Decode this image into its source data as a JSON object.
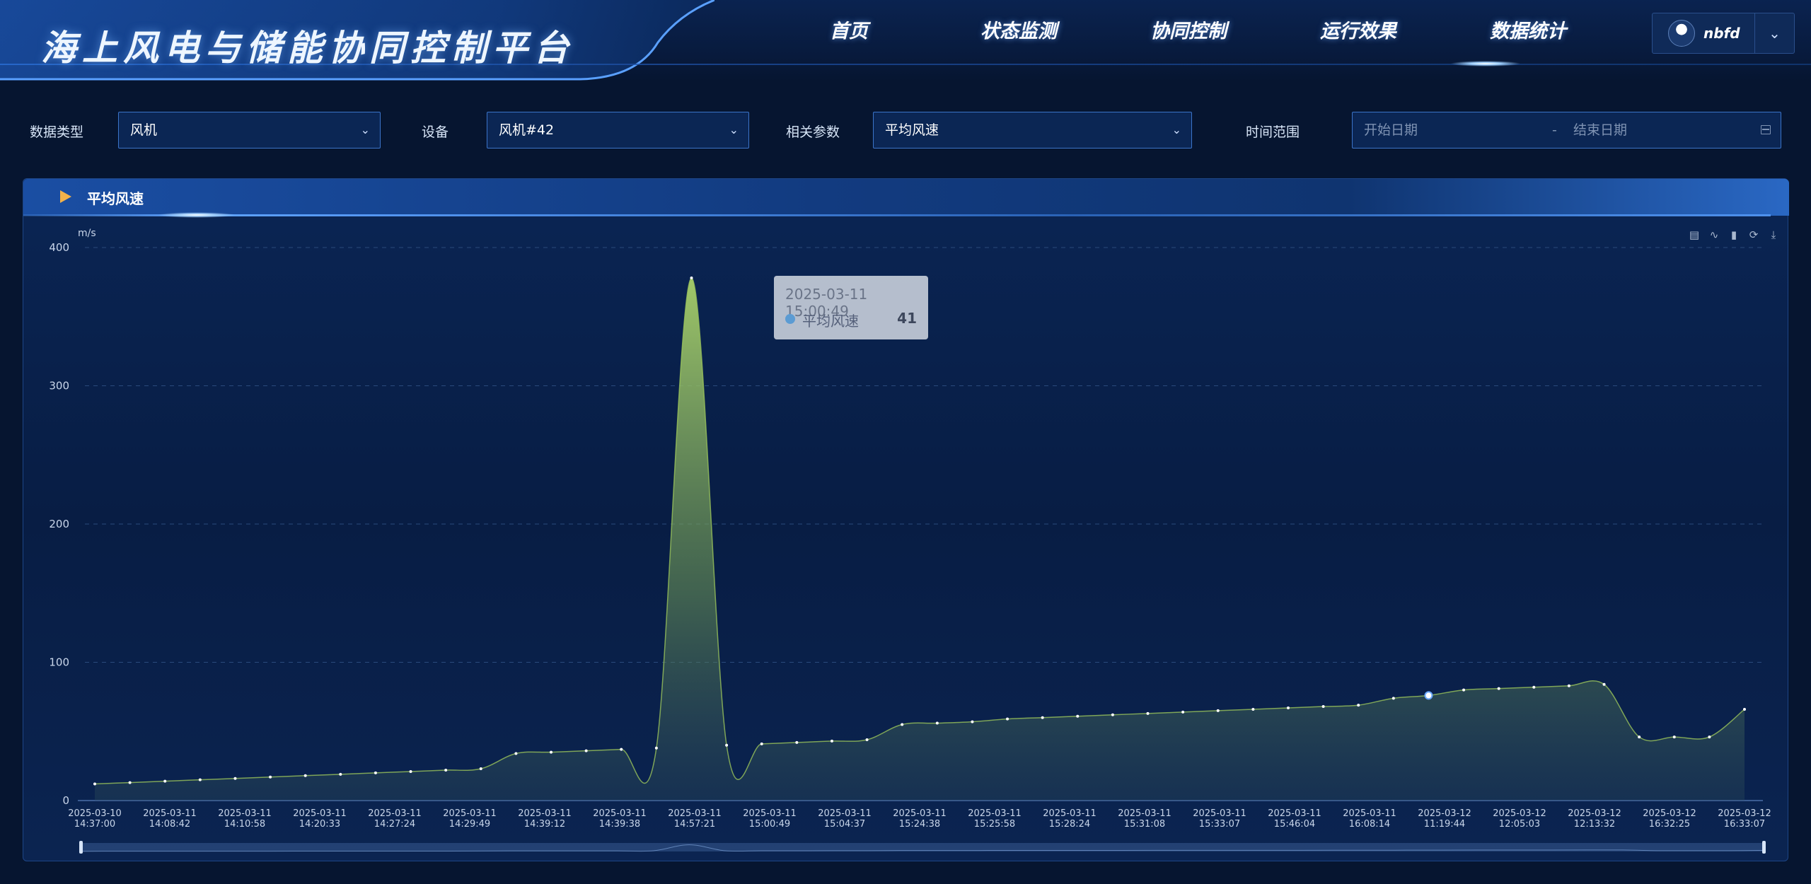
{
  "app": {
    "title": "海上风电与储能协同控制平台"
  },
  "nav": [
    {
      "label": "首页"
    },
    {
      "label": "状态监测"
    },
    {
      "label": "协同控制"
    },
    {
      "label": "运行效果"
    },
    {
      "label": "数据统计"
    }
  ],
  "user": {
    "name": "nbfd"
  },
  "filters": {
    "type_label": "数据类型",
    "type_value": "风机",
    "device_label": "设备",
    "device_value": "风机#42",
    "param_label": "相关参数",
    "param_value": "平均风速",
    "range_label": "时间范围",
    "start_placeholder": "开始日期",
    "separator": "-",
    "end_placeholder": "结束日期"
  },
  "panel": {
    "title": "平均风速"
  },
  "toolbox": [
    "data-view-icon",
    "line-icon",
    "bar-icon",
    "restore-icon",
    "download-icon"
  ],
  "tooltip": {
    "time": "2025-03-11 15:00:49",
    "series": "平均风速",
    "value": "41"
  },
  "colors": {
    "accent": "#3b74c9",
    "series": "#9ac35a",
    "tooltip_dot": "#5b9bd3"
  },
  "chart_data": {
    "type": "area",
    "ylabel": "m/s",
    "ylim": [
      0,
      400
    ],
    "yticks": [
      0,
      100,
      200,
      300,
      400
    ],
    "grid": true,
    "x_labels": [
      [
        "2025-03-10",
        "14:37:00"
      ],
      [
        "2025-03-11",
        "14:08:42"
      ],
      [
        "2025-03-11",
        "14:10:58"
      ],
      [
        "2025-03-11",
        "14:20:33"
      ],
      [
        "2025-03-11",
        "14:27:24"
      ],
      [
        "2025-03-11",
        "14:29:49"
      ],
      [
        "2025-03-11",
        "14:39:12"
      ],
      [
        "2025-03-11",
        "14:39:38"
      ],
      [
        "2025-03-11",
        "14:57:21"
      ],
      [
        "2025-03-11",
        "15:00:49"
      ],
      [
        "2025-03-11",
        "15:04:37"
      ],
      [
        "2025-03-11",
        "15:24:38"
      ],
      [
        "2025-03-11",
        "15:25:58"
      ],
      [
        "2025-03-11",
        "15:28:24"
      ],
      [
        "2025-03-11",
        "15:31:08"
      ],
      [
        "2025-03-11",
        "15:33:07"
      ],
      [
        "2025-03-11",
        "15:46:04"
      ],
      [
        "2025-03-11",
        "16:08:14"
      ],
      [
        "2025-03-12",
        "11:19:44"
      ],
      [
        "2025-03-12",
        "12:05:03"
      ],
      [
        "2025-03-12",
        "12:13:32"
      ],
      [
        "2025-03-12",
        "16:32:25"
      ],
      [
        "2025-03-12",
        "16:33:07"
      ]
    ],
    "values": [
      12,
      13,
      14,
      15,
      16,
      17,
      18,
      19,
      20,
      21,
      22,
      23,
      34,
      35,
      36,
      37,
      38,
      378,
      40,
      41,
      42,
      43,
      44,
      55,
      56,
      57,
      59,
      60,
      61,
      62,
      63,
      64,
      65,
      66,
      67,
      68,
      69,
      74,
      76,
      80,
      81,
      82,
      83,
      84,
      46,
      46,
      46,
      66
    ],
    "highlight_index": 38
  }
}
